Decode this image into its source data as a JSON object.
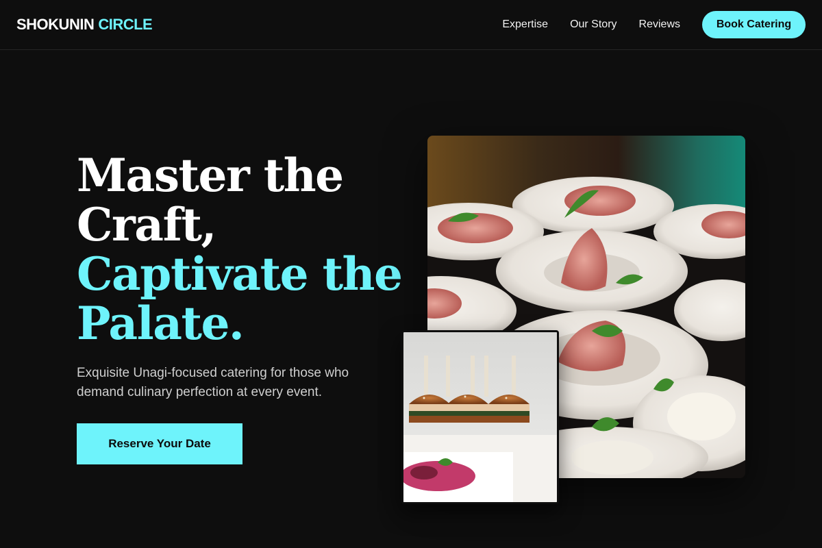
{
  "nav": {
    "brand_part1": "SHOKUNIN",
    "brand_part2": "CIRCLE",
    "links": [
      "Expertise",
      "Our Story",
      "Reviews"
    ],
    "cta": "Book Catering"
  },
  "hero": {
    "title_line1": "Master the",
    "title_line2": "Craft,",
    "title_line3": "Captivate the",
    "title_line4": "Palate.",
    "subtitle": "Exquisite Unagi-focused catering for those who demand culinary perfection at every event.",
    "cta": "Reserve Your Date"
  },
  "images": {
    "main_alt": "plated prosciutto appetizers",
    "small_alt": "mini slider burgers with skewers"
  },
  "colors": {
    "accent": "#6ef3fb",
    "background": "#0e0e0e"
  }
}
